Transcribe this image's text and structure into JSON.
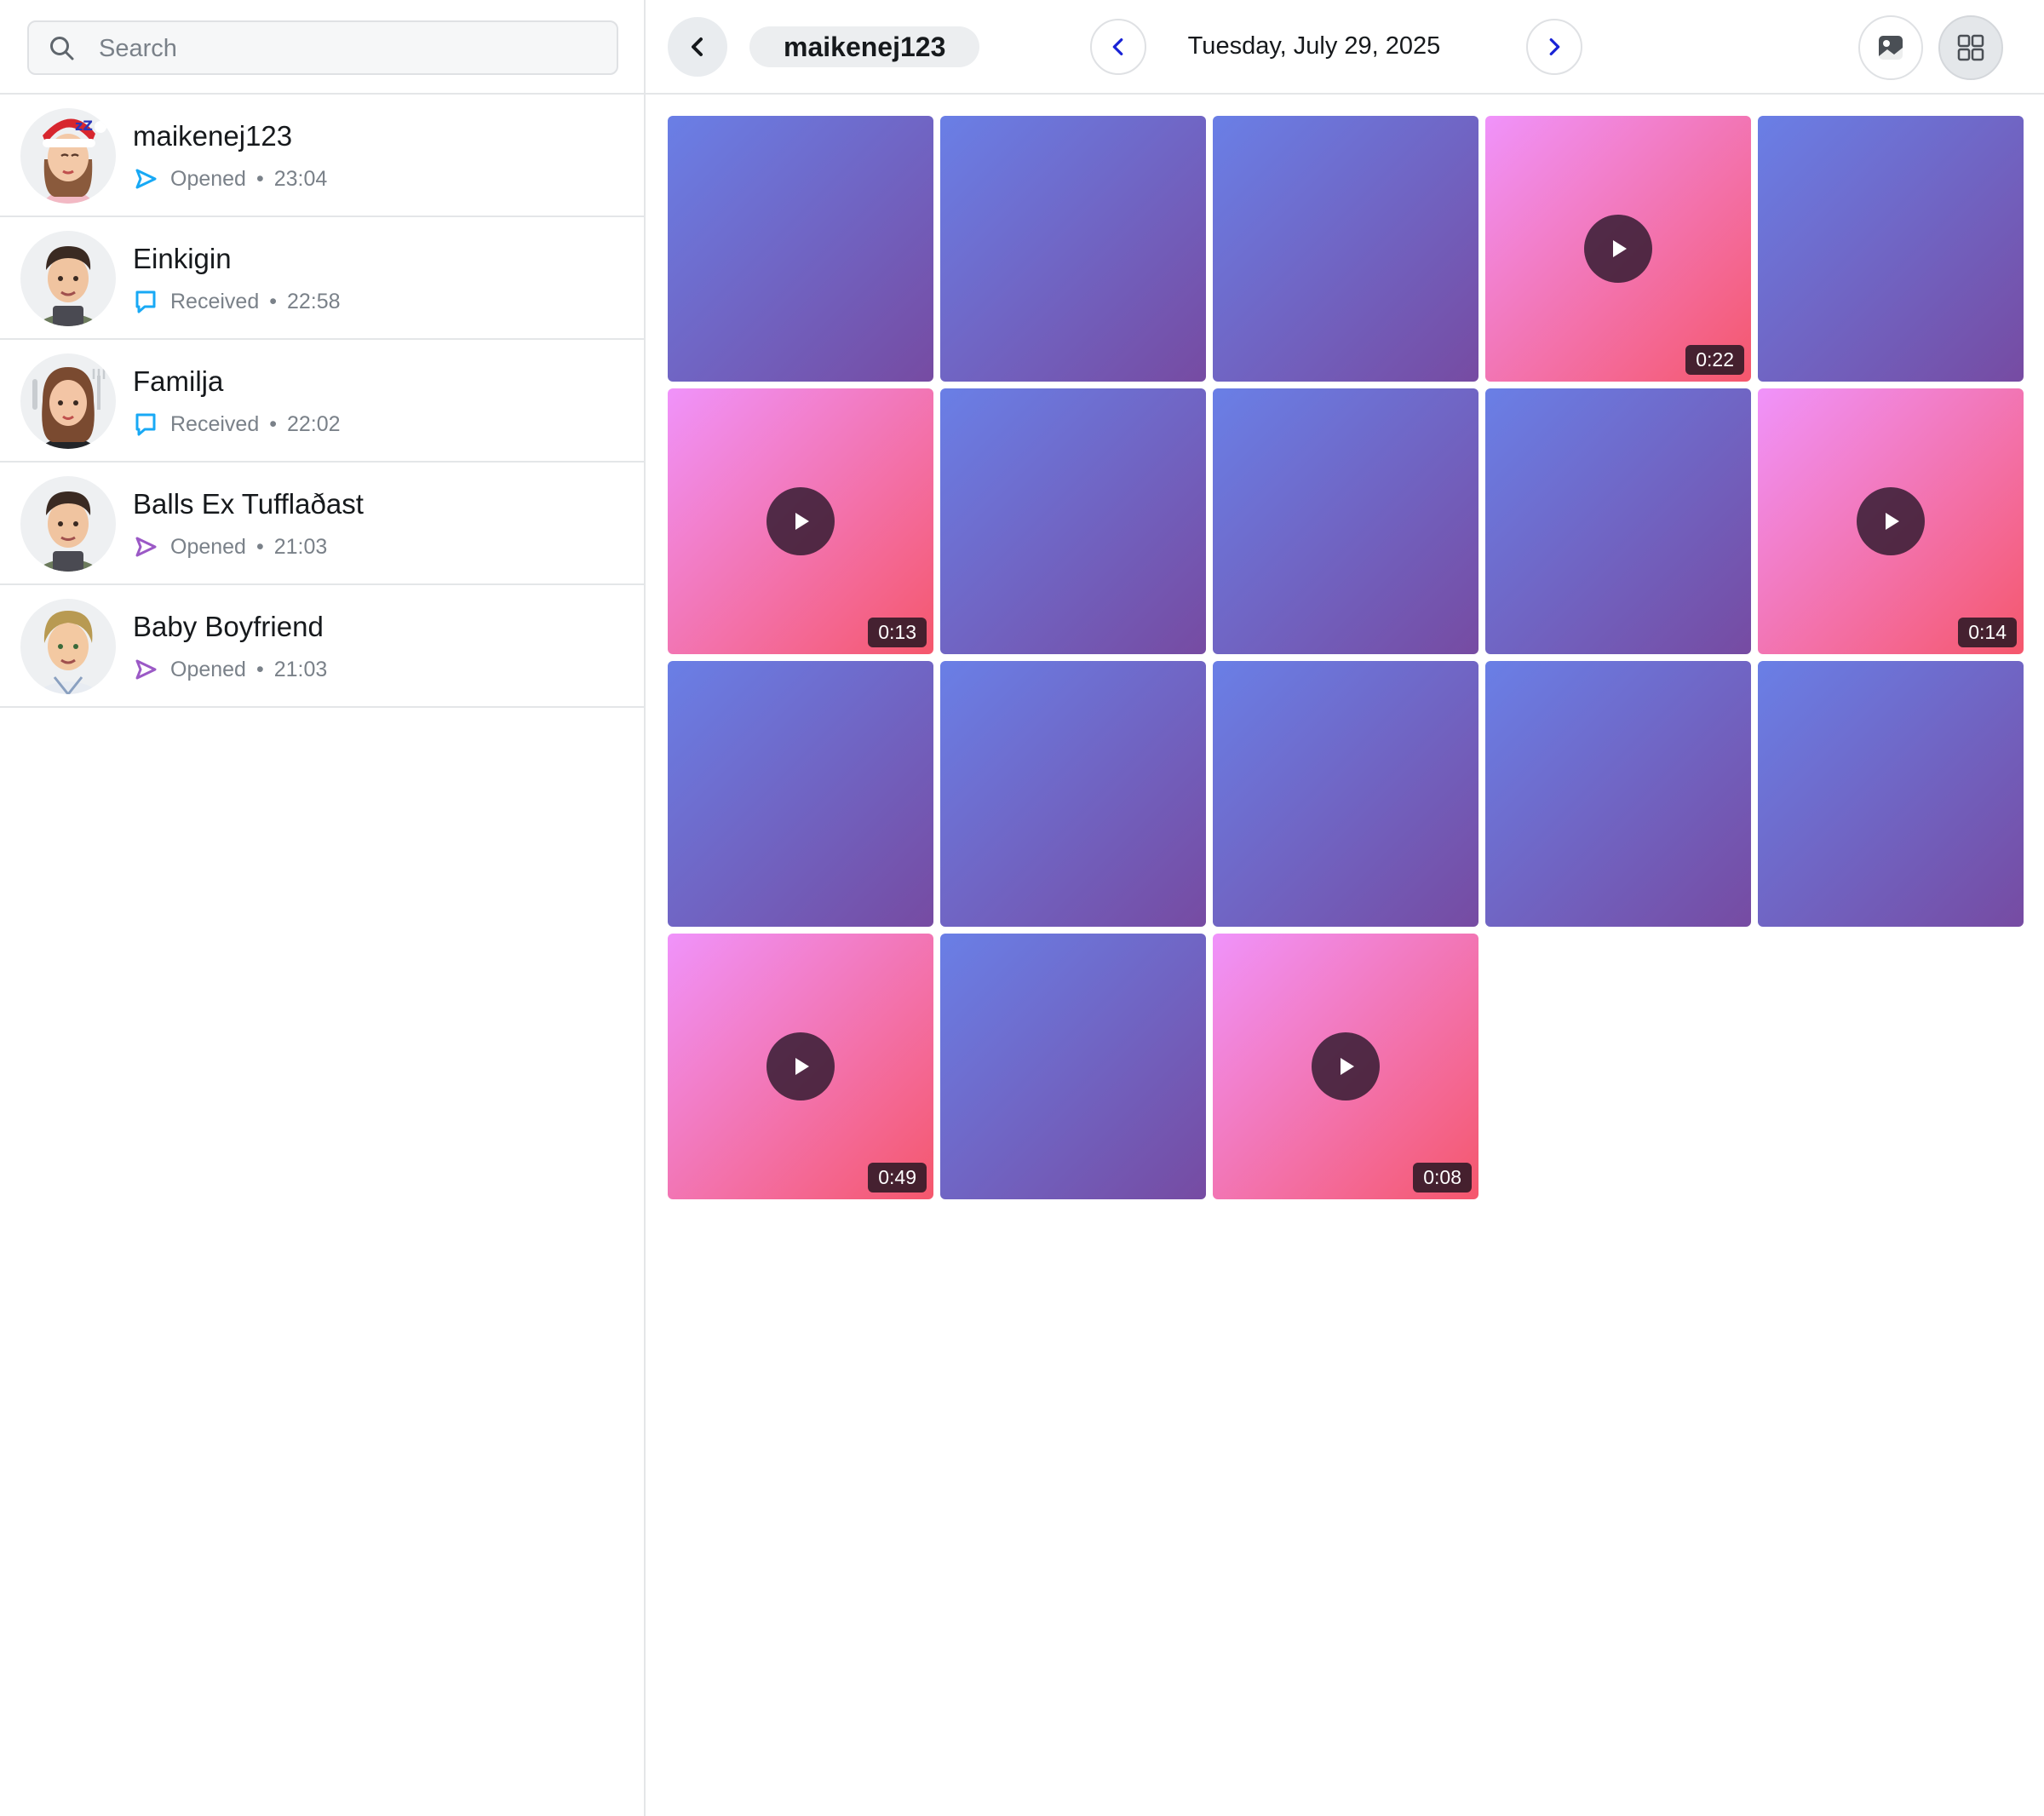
{
  "search": {
    "placeholder": "Search"
  },
  "chats": [
    {
      "name": "maikenej123",
      "status": "Opened",
      "time": "23:04",
      "status_icon": "send-arrow-icon",
      "status_color": "#18a9f5"
    },
    {
      "name": "Einkigin",
      "status": "Received",
      "time": "22:58",
      "status_icon": "chat-bubble-icon",
      "status_color": "#18a9f5"
    },
    {
      "name": "Familja",
      "status": "Received",
      "time": "22:02",
      "status_icon": "chat-bubble-icon",
      "status_color": "#18a9f5"
    },
    {
      "name": "Balls Ex Tufflaðast",
      "status": "Opened",
      "time": "21:03",
      "status_icon": "send-arrow-icon",
      "status_color": "#9b59c6"
    },
    {
      "name": "Baby Boyfriend",
      "status": "Opened",
      "time": "21:03",
      "status_icon": "send-arrow-icon",
      "status_color": "#9b59c6"
    }
  ],
  "separator": "•",
  "header": {
    "username": "maikenej123",
    "date": "Tuesday, July 29, 2025"
  },
  "colors": {
    "nav_arrow": "#1a24d6",
    "photo_gradient": [
      "#6a7fe6",
      "#764ba2"
    ],
    "video_gradient": [
      "#f093fb",
      "#f5576c"
    ]
  },
  "media": [
    {
      "type": "photo"
    },
    {
      "type": "photo"
    },
    {
      "type": "photo"
    },
    {
      "type": "video",
      "duration": "0:22"
    },
    {
      "type": "photo"
    },
    {
      "type": "video",
      "duration": "0:13"
    },
    {
      "type": "photo"
    },
    {
      "type": "photo"
    },
    {
      "type": "photo"
    },
    {
      "type": "video",
      "duration": "0:14"
    },
    {
      "type": "photo"
    },
    {
      "type": "photo"
    },
    {
      "type": "photo"
    },
    {
      "type": "photo"
    },
    {
      "type": "photo"
    },
    {
      "type": "video",
      "duration": "0:49"
    },
    {
      "type": "photo"
    },
    {
      "type": "video",
      "duration": "0:08"
    }
  ]
}
